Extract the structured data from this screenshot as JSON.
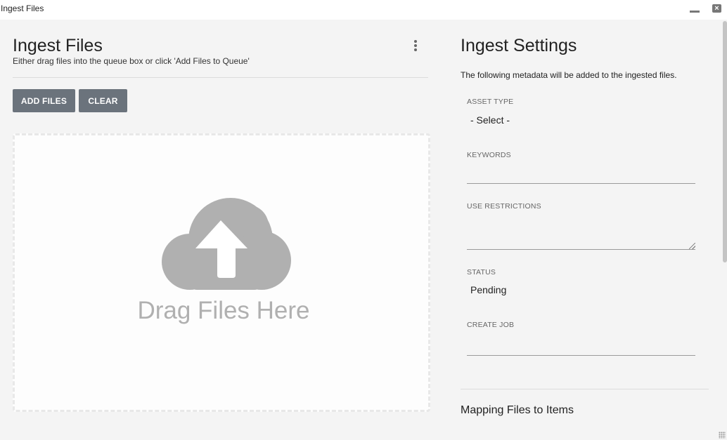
{
  "window": {
    "title": "Ingest Files"
  },
  "left": {
    "title": "Ingest Files",
    "subtitle": "Either drag files into the queue box or click 'Add Files to Queue'",
    "buttons": {
      "add_label": "ADD FILES",
      "clear_label": "CLEAR"
    },
    "dropzone": {
      "text": "Drag Files Here",
      "icon": "cloud-upload-icon"
    }
  },
  "right": {
    "title": "Ingest Settings",
    "description": "The following metadata will be added to the ingested files.",
    "fields": {
      "asset_type": {
        "label": "ASSET TYPE",
        "value": "- Select -"
      },
      "keywords": {
        "label": "KEYWORDS",
        "value": ""
      },
      "use_restrictions": {
        "label": "USE RESTRICTIONS",
        "value": ""
      },
      "status": {
        "label": "STATUS",
        "value": "Pending"
      },
      "create_job": {
        "label": "CREATE JOB",
        "value": ""
      }
    },
    "mapping_title": "Mapping Files to Items"
  },
  "colors": {
    "button_bg": "#6b737c",
    "panel_bg": "#f4f4f4",
    "dropzone_bg": "#fdfdfd",
    "icon_gray": "#b0b0b0"
  }
}
